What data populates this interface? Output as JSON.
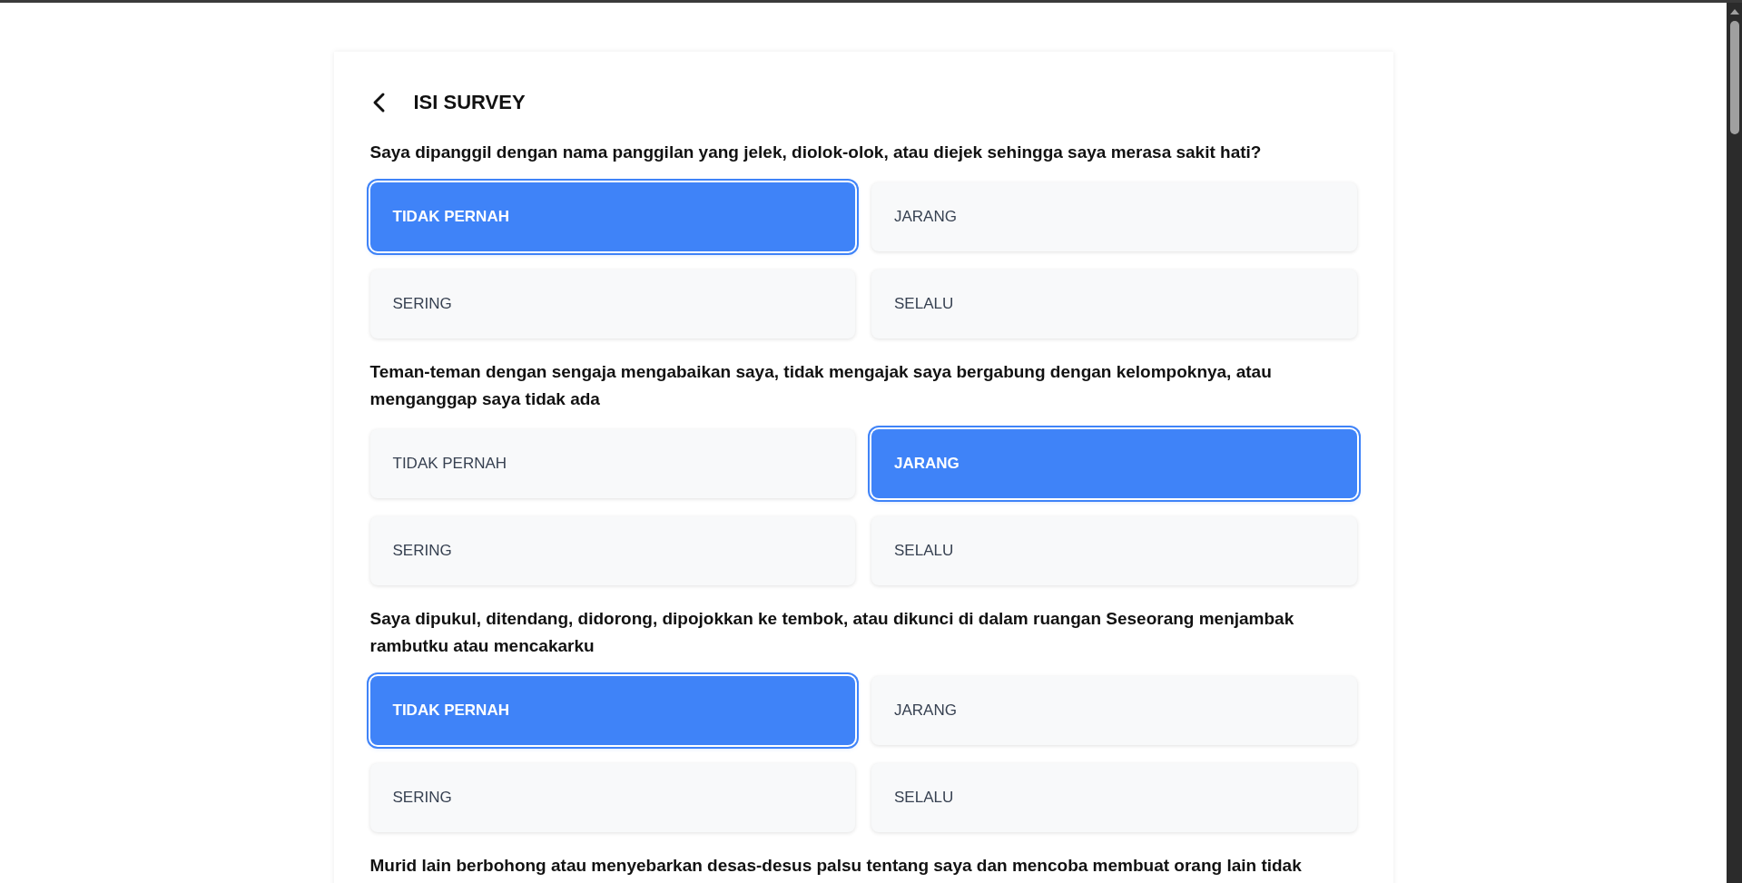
{
  "header": {
    "title": "ISI SURVEY"
  },
  "questions": [
    {
      "text": "Saya dipanggil dengan nama panggilan yang jelek, diolok-olok, atau diejek sehingga saya merasa sakit hati?",
      "options": [
        {
          "label": "TIDAK PERNAH",
          "selected": true
        },
        {
          "label": "JARANG",
          "selected": false
        },
        {
          "label": "SERING",
          "selected": false
        },
        {
          "label": "SELALU",
          "selected": false
        }
      ]
    },
    {
      "text": "Teman-teman dengan sengaja mengabaikan saya, tidak mengajak saya bergabung dengan kelompoknya, atau menganggap saya tidak ada",
      "options": [
        {
          "label": "TIDAK PERNAH",
          "selected": false
        },
        {
          "label": "JARANG",
          "selected": true
        },
        {
          "label": "SERING",
          "selected": false
        },
        {
          "label": "SELALU",
          "selected": false
        }
      ]
    },
    {
      "text": "Saya dipukul, ditendang, didorong, dipojokkan ke tembok, atau dikunci di dalam ruangan Seseorang menjambak rambutku atau mencakarku",
      "options": [
        {
          "label": "TIDAK PERNAH",
          "selected": true
        },
        {
          "label": "JARANG",
          "selected": false
        },
        {
          "label": "SERING",
          "selected": false
        },
        {
          "label": "SELALU",
          "selected": false
        }
      ]
    },
    {
      "text": "Murid lain berbohong atau menyebarkan desas-desus palsu tentang saya dan mencoba membuat orang lain tidak"
    }
  ]
}
